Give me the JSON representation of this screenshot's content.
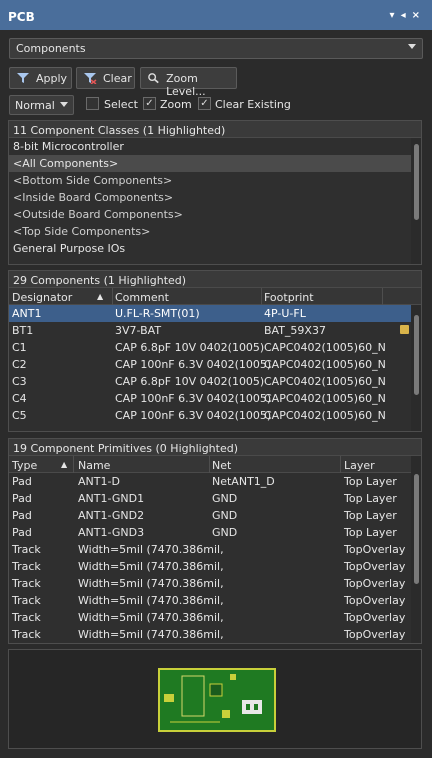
{
  "window": {
    "title": "PCB"
  },
  "filter_combo": {
    "value": "Components"
  },
  "toolbar": {
    "apply": "Apply",
    "clear": "Clear",
    "zoom_level": "Zoom Level..."
  },
  "options": {
    "mode": "Normal",
    "select_label": "Select",
    "select_checked": false,
    "zoom_label": "Zoom",
    "zoom_checked": true,
    "clear_existing_label": "Clear Existing",
    "clear_existing_checked": true
  },
  "classes": {
    "header": "11 Component Classes (1 Highlighted)",
    "items": [
      "8-bit Microcontroller",
      "<All Components>",
      "<Bottom Side Components>",
      "<Inside Board Components>",
      "<Outside Board Components>",
      "<Top Side Components>",
      "General Purpose IOs"
    ]
  },
  "components": {
    "header": "29 Components (1 Highlighted)",
    "columns": [
      "Designator",
      "Comment",
      "Footprint"
    ],
    "rows": [
      [
        "ANT1",
        "U.FL-R-SMT(01)",
        "4P-U-FL"
      ],
      [
        "BT1",
        "3V7-BAT",
        "BAT_59X37"
      ],
      [
        "C1",
        "CAP 6.8pF 10V 0402(1005)",
        "CAPC0402(1005)60_N"
      ],
      [
        "C2",
        "CAP 100nF 6.3V 0402(1005)",
        "CAPC0402(1005)60_N"
      ],
      [
        "C3",
        "CAP 6.8pF 10V 0402(1005)",
        "CAPC0402(1005)60_N"
      ],
      [
        "C4",
        "CAP 100nF 6.3V 0402(1005)",
        "CAPC0402(1005)60_N"
      ],
      [
        "C5",
        "CAP 100nF 6.3V 0402(1005)",
        "CAPC0402(1005)60_N"
      ]
    ]
  },
  "primitives": {
    "header": "19 Component Primitives (0 Highlighted)",
    "columns": [
      "Type",
      "Name",
      "Net",
      "Layer"
    ],
    "rows": [
      [
        "Pad",
        "ANT1-D",
        "NetANT1_D",
        "Top Layer"
      ],
      [
        "Pad",
        "ANT1-GND1",
        "GND",
        "Top Layer"
      ],
      [
        "Pad",
        "ANT1-GND2",
        "GND",
        "Top Layer"
      ],
      [
        "Pad",
        "ANT1-GND3",
        "GND",
        "Top Layer"
      ],
      [
        "Track",
        "Width=5mil (7470.386mil,",
        "",
        "TopOverlay"
      ],
      [
        "Track",
        "Width=5mil (7470.386mil,",
        "",
        "TopOverlay"
      ],
      [
        "Track",
        "Width=5mil (7470.386mil,",
        "",
        "TopOverlay"
      ],
      [
        "Track",
        "Width=5mil (7470.386mil,",
        "",
        "TopOverlay"
      ],
      [
        "Track",
        "Width=5mil (7470.386mil,",
        "",
        "TopOverlay"
      ],
      [
        "Track",
        "Width=5mil (7470.386mil,",
        "",
        "TopOverlay"
      ]
    ]
  },
  "colors": {
    "title_bar": "#4a6e9b",
    "selection": "#3d5f8b",
    "board": "#1f7a22"
  }
}
